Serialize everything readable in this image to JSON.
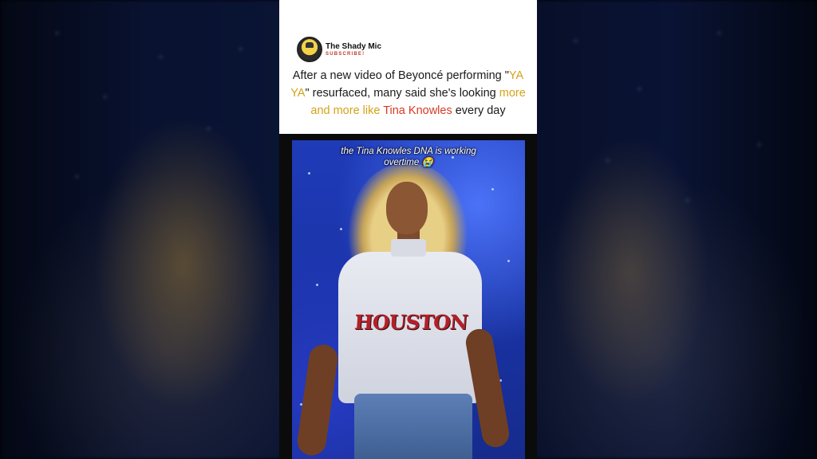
{
  "channel": {
    "name": "The Shady Mic",
    "subscribe_label": "SUBSCRIBE!"
  },
  "headline": {
    "part1": "After a new video of Beyoncé performing \"",
    "highlight1": "YA YA",
    "part2": "\" resurfaced, many said she's looking ",
    "highlight2": "more and more like",
    "highlight3": "Tina Knowles",
    "part3": " every day"
  },
  "video": {
    "caption": "the Tina Knowles DNA is working overtime 😭",
    "shirt_text": "HOUSTON"
  },
  "colors": {
    "gold": "#d4a21a",
    "red": "#d63a26",
    "stage_blue": "#1f3bb8"
  }
}
